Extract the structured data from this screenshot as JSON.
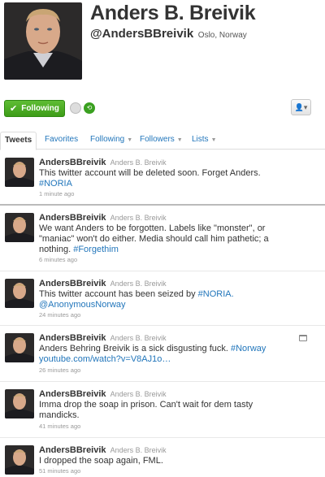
{
  "profile": {
    "name": "Anders B. Breivik",
    "handle": "@AndersBBreivik",
    "location": "Oslo, Norway",
    "follow_label": "Following",
    "colors": {
      "follow_green": "#4aab24",
      "link": "#2276bb"
    }
  },
  "tabs": [
    {
      "label": "Tweets"
    },
    {
      "label": "Favorites"
    },
    {
      "label": "Following"
    },
    {
      "label": "Followers"
    },
    {
      "label": "Lists"
    }
  ],
  "tweets": [
    {
      "user": "AndersBBreivik",
      "real_name": "Anders B. Breivik",
      "line1": "This twitter account will be deleted soon. Forget Anders.",
      "line2_link": "#NORIA",
      "time": "1 minute ago"
    },
    {
      "user": "AndersBBreivik",
      "real_name": "Anders B. Breivik",
      "line1": "We want Anders to be forgotten. Labels like \"monster\", or",
      "line2": "\"maniac\" won't do either. Media should call him pathetic; a",
      "line3_text": "nothing.",
      "line3_link": "#Forgethim",
      "time": "6 minutes ago"
    },
    {
      "user": "AndersBBreivik",
      "real_name": "Anders B. Breivik",
      "line1_text": "This twitter account has been seized by",
      "line1_link": "#NORIA.",
      "line2_link": "@AnonymousNorway",
      "time": "24 minutes ago"
    },
    {
      "user": "AndersBBreivik",
      "real_name": "Anders B. Breivik",
      "line1_text": "Anders Behring Breivik is a sick disgusting fuck.",
      "line1_link": "#Norway",
      "line2_link": "youtube.com/watch?v=V8AJ1o…",
      "time": "26 minutes ago"
    },
    {
      "user": "AndersBBreivik",
      "real_name": "Anders B. Breivik",
      "line1": "Imma drop the soap in prison. Can't wait for dem tasty",
      "line2": "mandicks.",
      "time": "41 minutes ago"
    },
    {
      "user": "AndersBBreivik",
      "real_name": "Anders B. Breivik",
      "line1": "I dropped the soap again, FML.",
      "time": "51 minutes ago"
    }
  ]
}
